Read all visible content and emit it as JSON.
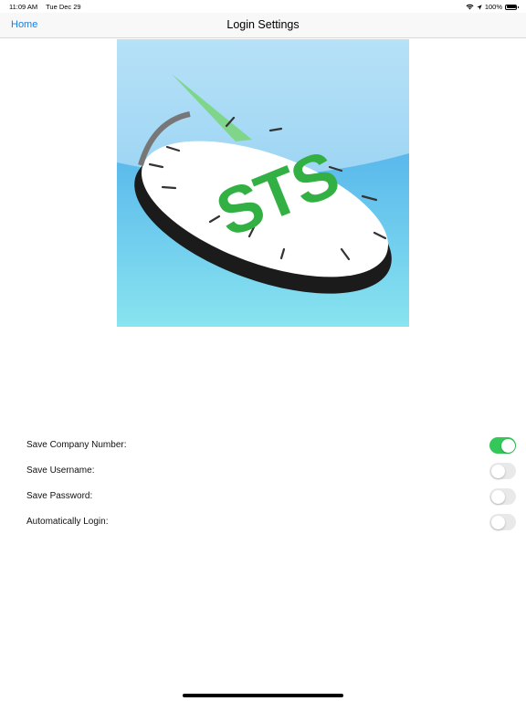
{
  "status_bar": {
    "time": "11:09 AM",
    "date": "Tue Dec 29",
    "battery": "100%",
    "icons": [
      "wifi-icon",
      "location-arrow-icon",
      "battery-icon"
    ]
  },
  "nav": {
    "back_label": "Home",
    "title": "Login Settings"
  },
  "logo": {
    "text": "STS",
    "colors": {
      "sky_top": "#b3e0f8",
      "sky_bottom": "#8ee8ee",
      "green": "#3cb64a",
      "light_green": "#7fd68a"
    }
  },
  "settings": [
    {
      "label": "Save Company Number:",
      "on": true
    },
    {
      "label": "Save Username:",
      "on": false
    },
    {
      "label": "Save Password:",
      "on": false
    },
    {
      "label": "Automatically Login:",
      "on": false
    }
  ],
  "colors": {
    "accent": "#1a7ee0",
    "toggle_on": "#34c759",
    "toggle_off": "#e9e9ea"
  }
}
